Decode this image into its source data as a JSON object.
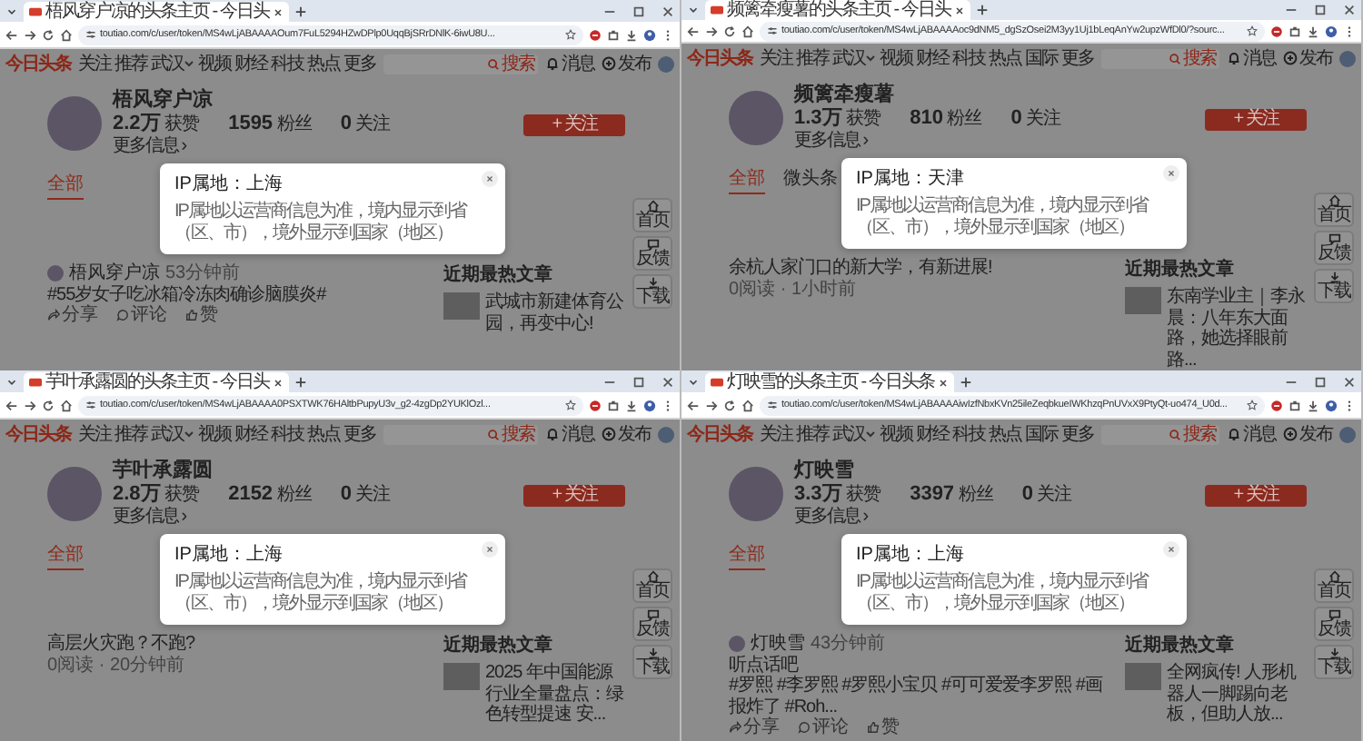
{
  "windows": [
    {
      "tab_title": "梧风穿户凉的头条主页 - 今日头",
      "url": "toutiao.com/c/user/token/MS4wLjABAAAAOum7FuL5294HZwDPlp0UqqBjSRrDNlK-6iwU8U...",
      "logo": "今日头条",
      "nav": [
        {
          "label": "关注",
          "dropdown": false
        },
        {
          "label": "推荐",
          "dropdown": false
        },
        {
          "label": "武汉",
          "dropdown": true
        },
        {
          "label": "视频",
          "dropdown": false
        },
        {
          "label": "财经",
          "dropdown": false
        },
        {
          "label": "科技",
          "dropdown": false
        },
        {
          "label": "热点",
          "dropdown": false
        },
        {
          "label": "更多",
          "dropdown": false
        }
      ],
      "search_button": "搜索",
      "header_actions": [
        "消息",
        "发布"
      ],
      "profile": {
        "name": "梧风穿户凉",
        "stats": [
          "**2.2万** 获赞",
          "**1595** 粉丝",
          "**0** 关注"
        ],
        "more": "更多信息 ›"
      },
      "follow_button": "+ 关注",
      "tabs": [
        {
          "label": "全部",
          "selected": true
        }
      ],
      "feed": [
        {
          "kind": "post",
          "author": "梧风穿户凉",
          "time": "53分钟前",
          "text": [
            "#55岁女子吃冰箱冷冻肉确诊脑膜炎#"
          ],
          "actions": [
            "分享",
            "评论",
            "赞"
          ]
        }
      ],
      "hot_title": "近期最热文章",
      "hot": [
        {
          "title": "武城市新建体育公园，再变中心!"
        }
      ],
      "side": [
        "首页",
        "反馈",
        "下载"
      ],
      "popup": {
        "title": "IP属地：上海",
        "note": "IP属地以运营商信息为准，境内显示到省（区、市），境外显示到国家（地区）"
      }
    },
    {
      "tab_title": "频篱牵瘦薯的头条主页 - 今日头",
      "url": "toutiao.com/c/user/token/MS4wLjABAAAAoc9dNM5_dgSzOsei2M3yy1Uj1bLeqAnYw2upzWfDl0/?sourc...",
      "logo": "今日头条",
      "nav": [
        {
          "label": "关注",
          "dropdown": false
        },
        {
          "label": "推荐",
          "dropdown": false
        },
        {
          "label": "武汉",
          "dropdown": true
        },
        {
          "label": "视频",
          "dropdown": false
        },
        {
          "label": "财经",
          "dropdown": false
        },
        {
          "label": "科技",
          "dropdown": false
        },
        {
          "label": "热点",
          "dropdown": false
        },
        {
          "label": "国际",
          "dropdown": false
        },
        {
          "label": "更多",
          "dropdown": false
        }
      ],
      "search_button": "搜索",
      "header_actions": [
        "消息",
        "发布"
      ],
      "profile": {
        "name": "频篱牵瘦薯",
        "stats": [
          "**1.3万** 获赞",
          "**810** 粉丝",
          "**0** 关注"
        ],
        "more": "更多信息 ›"
      },
      "follow_button": "+ 关注",
      "tabs": [
        {
          "label": "全部",
          "selected": true
        },
        {
          "label": "微头条",
          "selected": false
        }
      ],
      "feed": [
        {
          "kind": "article",
          "title": "余杭人家门口的新大学，有新进展!",
          "meta": "0阅读 · 1小时前"
        }
      ],
      "hot_title": "近期最热文章",
      "hot": [
        {
          "title": "东南学业主｜李永晨：八年东大面路，她选择眼前路..."
        }
      ],
      "side": [
        "首页",
        "反馈",
        "下载"
      ],
      "popup": {
        "title": "IP属地：天津",
        "note": "IP属地以运营商信息为准，境内显示到省（区、市），境外显示到国家（地区）"
      }
    },
    {
      "tab_title": "芋叶承露圆的头条主页 - 今日头",
      "url": "toutiao.com/c/user/token/MS4wLjABAAAA0PSXTWK76HAltbPupyU3v_g2-4zgDp2YUKlOzl...",
      "logo": "今日头条",
      "nav": [
        {
          "label": "关注",
          "dropdown": false
        },
        {
          "label": "推荐",
          "dropdown": false
        },
        {
          "label": "武汉",
          "dropdown": true
        },
        {
          "label": "视频",
          "dropdown": false
        },
        {
          "label": "财经",
          "dropdown": false
        },
        {
          "label": "科技",
          "dropdown": false
        },
        {
          "label": "热点",
          "dropdown": false
        },
        {
          "label": "更多",
          "dropdown": false
        }
      ],
      "search_button": "搜索",
      "header_actions": [
        "消息",
        "发布"
      ],
      "profile": {
        "name": "芋叶承露圆",
        "stats": [
          "**2.8万** 获赞",
          "**2152** 粉丝",
          "**0** 关注"
        ],
        "more": "更多信息 ›"
      },
      "follow_button": "+ 关注",
      "tabs": [
        {
          "label": "全部",
          "selected": true
        }
      ],
      "feed": [
        {
          "kind": "article",
          "title": "高层火灾跑？不跑?",
          "meta": "0阅读 · 20分钟前"
        }
      ],
      "hot_title": "近期最热文章",
      "hot": [
        {
          "title": "2025 年中国能源行业全量盘点：绿色转型提速 安..."
        }
      ],
      "side": [
        "首页",
        "反馈",
        "下载"
      ],
      "popup": {
        "title": "IP属地：上海",
        "note": "IP属地以运营商信息为准，境内显示到省（区、市），境外显示到国家（地区）"
      }
    },
    {
      "tab_title": "灯映雪的头条主页 - 今日头条",
      "url": "toutiao.com/c/user/token/MS4wLjABAAAAiwIzfNbxKVn25ileZeqbkueIWKhzqPnUVxX9PtyQt-uo474_U0d...",
      "logo": "今日头条",
      "nav": [
        {
          "label": "关注",
          "dropdown": false
        },
        {
          "label": "推荐",
          "dropdown": false
        },
        {
          "label": "武汉",
          "dropdown": true
        },
        {
          "label": "视频",
          "dropdown": false
        },
        {
          "label": "财经",
          "dropdown": false
        },
        {
          "label": "科技",
          "dropdown": false
        },
        {
          "label": "热点",
          "dropdown": false
        },
        {
          "label": "国际",
          "dropdown": false
        },
        {
          "label": "更多",
          "dropdown": false
        }
      ],
      "search_button": "搜索",
      "header_actions": [
        "消息",
        "发布"
      ],
      "profile": {
        "name": "灯映雪",
        "stats": [
          "**3.3万** 获赞",
          "**3397** 粉丝",
          "**0** 关注"
        ],
        "more": "更多信息 ›"
      },
      "follow_button": "+ 关注",
      "tabs": [
        {
          "label": "全部",
          "selected": true
        }
      ],
      "feed": [
        {
          "kind": "post",
          "author": "灯映雪",
          "time": "43分钟前",
          "text": [
            "听点话吧",
            "#罗熙 #李罗熙 #罗熙小宝贝 #可可爱爱李罗熙 #画报炸了 #Roh..."
          ],
          "actions": [
            "分享",
            "评论",
            "赞"
          ]
        }
      ],
      "hot_title": "近期最热文章",
      "hot": [
        {
          "title": "全网疯传! 人形机器人一脚踢向老板，但助人放..."
        }
      ],
      "side": [
        "首页",
        "反馈",
        "下载"
      ],
      "popup": {
        "title": "IP属地：上海",
        "note": "IP属地以运营商信息为准，境内显示到省（区、市），境外显示到国家（地区）"
      }
    }
  ]
}
